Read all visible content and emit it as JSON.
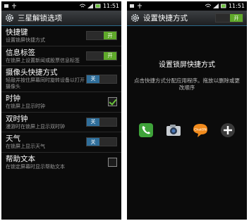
{
  "left": {
    "status": {
      "time": "11:51"
    },
    "title": "三星解锁选项",
    "items": [
      {
        "label": "快捷键",
        "sub": "设置锁屏快捷方式",
        "control": "toggle",
        "state": "开",
        "on": true
      },
      {
        "label": "信息标签",
        "sub": "在锁屏上设置新闻或股票信息标签",
        "control": "toggle",
        "state": "开",
        "on": true
      },
      {
        "label": "摄像头快捷方式",
        "sub": "轻敲并按住屏幕同时旋转设备以打开摄像头",
        "control": "toggle",
        "state": "关",
        "on": false
      },
      {
        "label": "时钟",
        "sub": "在锁屏上显示时钟",
        "control": "checkbox",
        "checked": true
      },
      {
        "label": "双时钟",
        "sub": "漫游时在锁屏上显示双时钟",
        "control": "toggle",
        "state": "关",
        "on": false
      },
      {
        "label": "天气",
        "sub": "在锁屏上显示天气",
        "control": "toggle",
        "state": "关",
        "on": false
      },
      {
        "label": "帮助文本",
        "sub": "在锁定屏幕时显示帮助文本",
        "control": "checkbox",
        "checked": false
      }
    ]
  },
  "right": {
    "status": {
      "time": "11:51"
    },
    "title": "设置快捷方式",
    "title_toggle": "开",
    "heading": "设置锁屏快捷方式",
    "description": "点击快捷方式分配应用程序。拖放以删除或更改顺序",
    "shortcuts": [
      "phone-icon",
      "camera-icon",
      "chaton-icon",
      "add-icon"
    ],
    "chaton_text": "ChatON"
  },
  "colors": {
    "toggle_on": "#5fa92a",
    "toggle_off": "#2f6e9a",
    "accent": "#2c6a8a"
  }
}
